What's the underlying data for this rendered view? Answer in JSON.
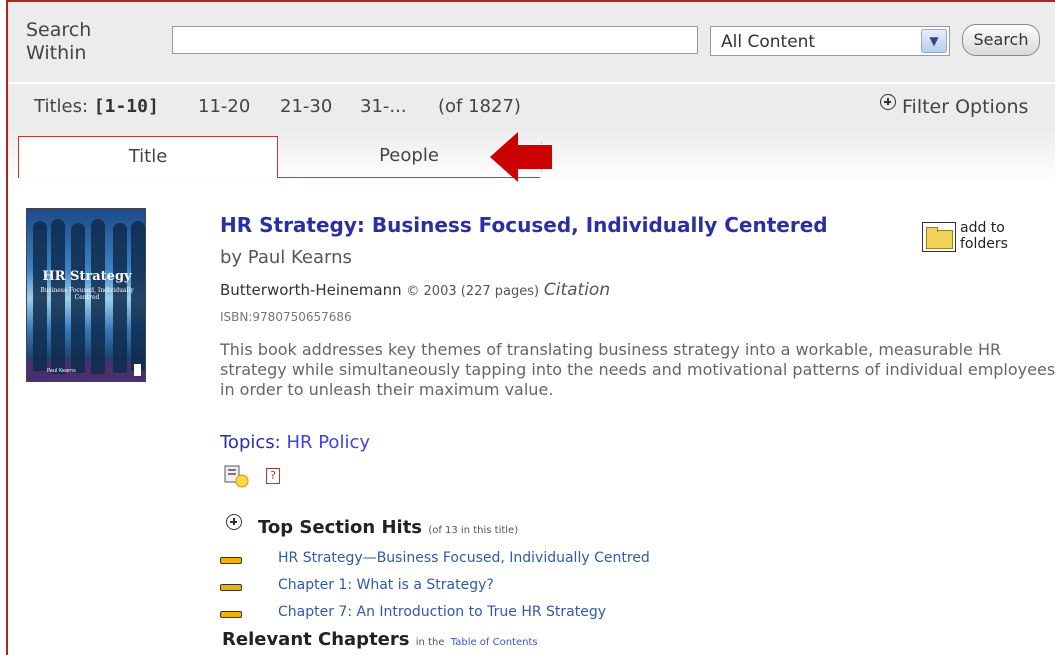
{
  "search": {
    "label": "Search Within",
    "query": "",
    "scope_selected": "All Content",
    "button_label": "Search"
  },
  "pager": {
    "prefix": "Titles:",
    "current": "[1-10]",
    "pages": [
      "11-20",
      "21-30",
      "31-..."
    ],
    "total": "(of 1827)",
    "filter_label": "Filter Options"
  },
  "tabs": [
    {
      "label": "Title",
      "active": true
    },
    {
      "label": "People",
      "active": false
    }
  ],
  "annotation": {
    "arrow_color": "#cc0000",
    "arrow_icon": "arrow-left-icon"
  },
  "cover": {
    "title": "HR Strategy",
    "subtitle": "Business Focused, Individually Centred",
    "author": "Paul Kearns"
  },
  "result": {
    "title": "HR Strategy: Business Focused, Individually Centered",
    "by": "by Paul Kearns",
    "publisher": "Butterworth-Heinemann",
    "pub_details": "© 2003 (227 pages)",
    "citation": "Citation",
    "isbn": "ISBN:9780750657686",
    "description": "This book addresses key themes of translating business strategy into a workable, measurable HR strategy while simultaneously tapping into the needs and motivational patterns of individual employees in order to unleash their maximum value.",
    "topics_label": "Topics:",
    "topic": "HR Policy",
    "folder_label_1": "add to",
    "folder_label_2": "folders"
  },
  "sections": {
    "heading": "Top Section Hits",
    "heading_note": "(of 13 in this title)",
    "hits": [
      "HR Strategy—Business Focused, Individually Centred",
      "Chapter 1: What is a Strategy?",
      "Chapter 7: An Introduction to True HR Strategy"
    ],
    "relevant_heading": "Relevant Chapters",
    "relevant_note": "in the",
    "relevant_link": "Table of Contents"
  },
  "colors": {
    "link": "#2a2fa6",
    "tab_border": "#cc3333",
    "accent_bar": "#f0b400"
  }
}
